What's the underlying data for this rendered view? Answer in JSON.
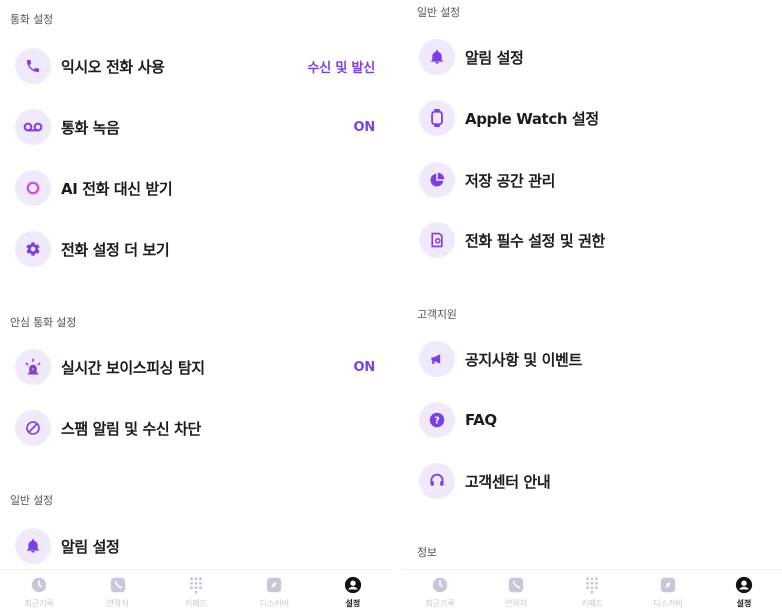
{
  "accent_color": "#7b3fe4",
  "left": {
    "sections": [
      {
        "header": "통화 설정",
        "items": [
          {
            "label": "익시오 전화 사용",
            "value": "수신 및 발신",
            "icon": "phone-icon"
          },
          {
            "label": "통화 녹음",
            "value": "ON",
            "icon": "voicemail-icon"
          },
          {
            "label": "AI 전화 대신 받기",
            "value": "",
            "icon": "ai-ring-icon"
          },
          {
            "label": "전화 설정 더 보기",
            "value": "",
            "icon": "gear-icon"
          }
        ]
      },
      {
        "header": "안심 통화 설정",
        "items": [
          {
            "label": "실시간 보이스피싱 탐지",
            "value": "ON",
            "icon": "siren-icon"
          },
          {
            "label": "스팸 알림 및 수신 차단",
            "value": "",
            "icon": "block-icon"
          }
        ]
      },
      {
        "header": "일반 설정",
        "items": [
          {
            "label": "알림 설정",
            "value": "",
            "icon": "bell-icon"
          }
        ]
      }
    ]
  },
  "right": {
    "sections": [
      {
        "header": "일반 설정",
        "items": [
          {
            "label": "알림 설정",
            "icon": "bell-icon"
          },
          {
            "label": "Apple Watch 설정",
            "icon": "watch-icon"
          },
          {
            "label": "저장 공간 관리",
            "icon": "pie-chart-icon"
          },
          {
            "label": "전화 필수 설정 및 권한",
            "icon": "settings-doc-icon"
          }
        ]
      },
      {
        "header": "고객지원",
        "items": [
          {
            "label": "공지사항 및 이벤트",
            "icon": "megaphone-icon"
          },
          {
            "label": "FAQ",
            "icon": "question-icon"
          },
          {
            "label": "고객센터 안내",
            "icon": "headset-icon"
          }
        ]
      },
      {
        "header": "정보",
        "items": []
      }
    ]
  },
  "tabbar": [
    {
      "label": "최근기록",
      "icon": "clock-icon",
      "active": false
    },
    {
      "label": "연락처",
      "icon": "contacts-icon",
      "active": false
    },
    {
      "label": "키패드",
      "icon": "keypad-icon",
      "active": false
    },
    {
      "label": "디스커버",
      "icon": "discover-icon",
      "active": false
    },
    {
      "label": "설정",
      "icon": "user-icon",
      "active": true
    }
  ]
}
